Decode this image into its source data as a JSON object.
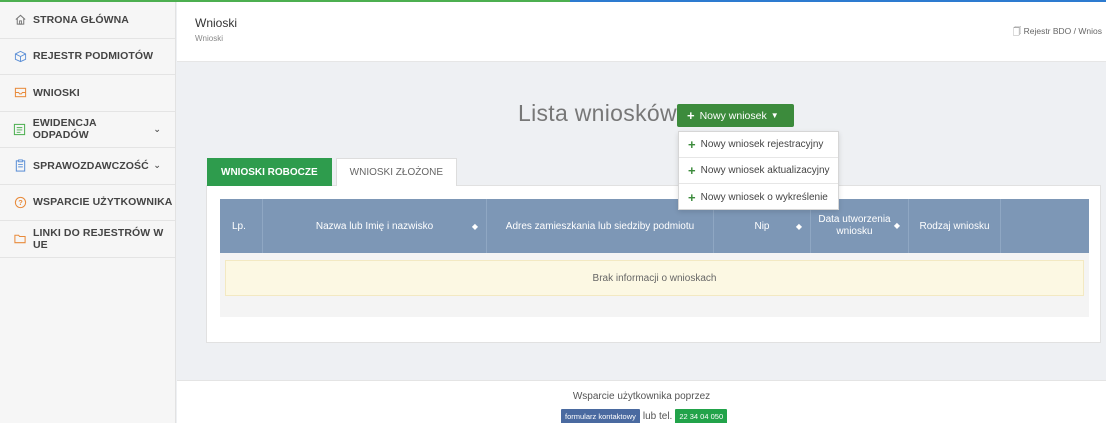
{
  "colors": {
    "accent_green": "#2e9c4d",
    "accent_blue": "#2d7bd0",
    "table_header": "#7d97b6",
    "empty_bg": "#fcf8e3"
  },
  "sidebar": {
    "items": [
      {
        "label": "STRONA GŁÓWNA",
        "icon": "home-icon",
        "expandable": false
      },
      {
        "label": "REJESTR PODMIOTÓW",
        "icon": "cube-icon",
        "expandable": false
      },
      {
        "label": "WNIOSKI",
        "icon": "inbox-icon",
        "expandable": false
      },
      {
        "label": "EWIDENCJA ODPADÓW",
        "icon": "document-icon",
        "expandable": true
      },
      {
        "label": "SPRAWOZDAWCZOŚĆ",
        "icon": "clipboard-icon",
        "expandable": true
      },
      {
        "label": "WSPARCIE UŻYTKOWNIKA",
        "icon": "help-icon",
        "expandable": false
      },
      {
        "label": "LINKI DO REJESTRÓW W UE",
        "icon": "folder-icon",
        "expandable": false
      }
    ]
  },
  "header": {
    "title": "Wnioski",
    "subtitle": "Wnioski",
    "breadcrumb": "Rejestr BDO  /  Wnios"
  },
  "main": {
    "heading": "Lista wniosków",
    "new_button": "Nowy wniosek",
    "dropdown": [
      "Nowy wniosek rejestracyjny",
      "Nowy wniosek aktualizacyjny",
      "Nowy wniosek o wykreślenie"
    ],
    "tabs": [
      {
        "label": "WNIOSKI ROBOCZE",
        "active": true
      },
      {
        "label": "WNIOSKI ZŁOŻONE",
        "active": false
      }
    ],
    "table": {
      "columns": [
        "Lp.",
        "Nazwa lub Imię i nazwisko",
        "Adres zamieszkania lub siedziby podmiotu",
        "Nip",
        "Data utworzenia wniosku",
        "Rodzaj wniosku",
        ""
      ],
      "empty_message": "Brak informacji o wnioskach"
    }
  },
  "footer": {
    "text": "Wsparcie użytkownika poprzez",
    "form_link": "formularz kontaktowy",
    "middle": "lub tel.",
    "phone": "22 34 04 050"
  }
}
